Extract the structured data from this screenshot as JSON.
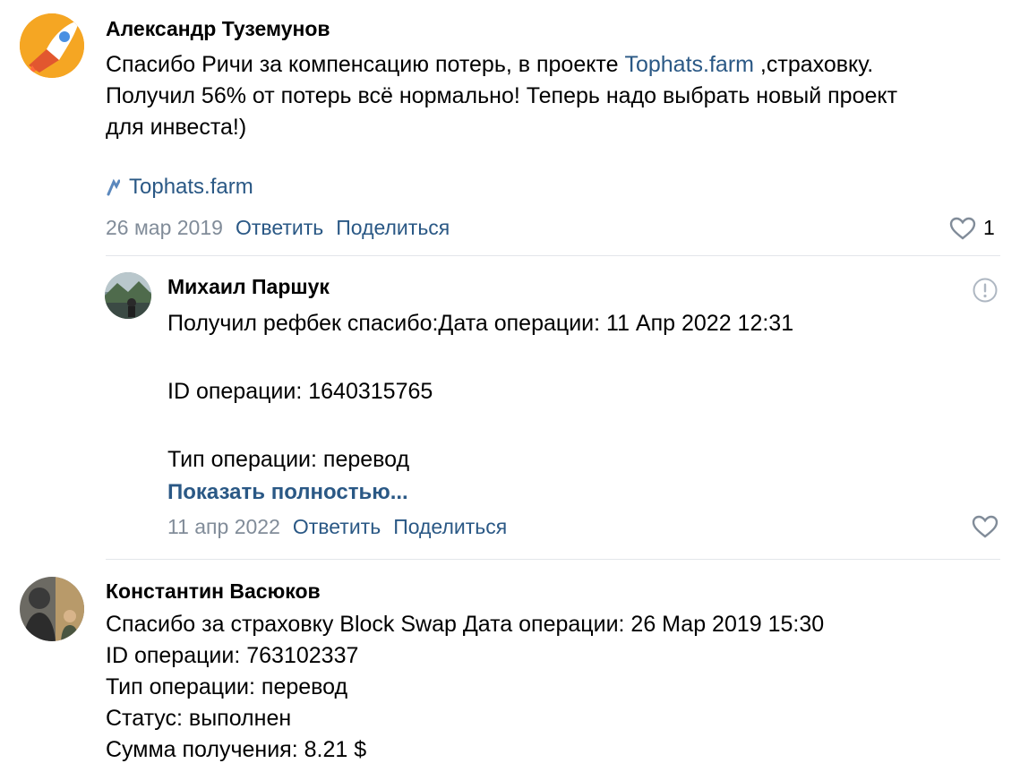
{
  "comments": [
    {
      "author": "Александр Туземунов",
      "text_lines": [
        {
          "before": "Спасибо Ричи за компенсацию потерь, в проекте ",
          "link": "Tophats.farm",
          "after": " ,страховку."
        },
        {
          "text": "Получил 56% от потерь всё нормально! Теперь надо выбрать новый проект"
        },
        {
          "text": "для инвеста!)"
        }
      ],
      "attachment": {
        "label": "Tophats.farm",
        "icon": "link-arrow-icon"
      },
      "date": "26 мар 2019",
      "reply_label": "Ответить",
      "share_label": "Поделиться",
      "likes": "1"
    },
    {
      "author": "Михаил Паршук",
      "text_lines": [
        {
          "text": "Получил рефбек спасибо:Дата операции: 11 Апр 2022 12:31"
        },
        {
          "text": ""
        },
        {
          "text": "ID операции: 1640315765"
        },
        {
          "text": ""
        },
        {
          "text": "Тип операции: перевод"
        }
      ],
      "show_more": "Показать полностью...",
      "date": "11 апр 2022",
      "reply_label": "Ответить",
      "share_label": "Поделиться",
      "report_icon": "report-icon"
    },
    {
      "author": "Константин Васюков",
      "text_lines": [
        {
          "text": "Спасибо за страховку Block Swap Дата операции: 26 Мар 2019 15:30"
        },
        {
          "text": "ID операции: 763102337"
        },
        {
          "text": "Тип операции: перевод"
        },
        {
          "text": "Статус: выполнен"
        },
        {
          "text": "Сумма получения: 8.21 $"
        }
      ]
    }
  ],
  "colors": {
    "link": "#2a5885",
    "meta": "#818c99",
    "divider": "#e3e6ea"
  }
}
